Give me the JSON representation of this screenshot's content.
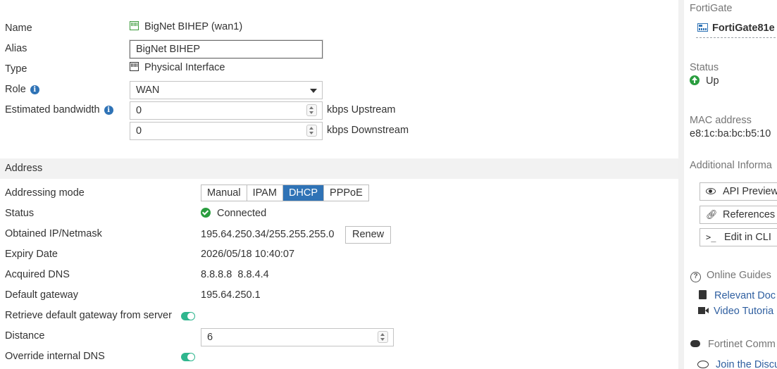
{
  "form": {
    "name_label": "Name",
    "name_value": "BigNet BIHEP (wan1)",
    "alias_label": "Alias",
    "alias_value": "BigNet BIHEP",
    "type_label": "Type",
    "type_value": "Physical Interface",
    "role_label": "Role",
    "role_value": "WAN",
    "bandwidth_label": "Estimated bandwidth",
    "upstream_value": "0",
    "upstream_unit": "kbps Upstream",
    "downstream_value": "0",
    "downstream_unit": "kbps Downstream"
  },
  "address": {
    "section_title": "Address",
    "mode_label": "Addressing mode",
    "modes": [
      "Manual",
      "IPAM",
      "DHCP",
      "PPPoE"
    ],
    "active_mode": "DHCP",
    "status_label": "Status",
    "status_value": "Connected",
    "ip_label": "Obtained IP/Netmask",
    "ip_value": "195.64.250.34/255.255.255.0",
    "renew_label": "Renew",
    "expiry_label": "Expiry Date",
    "expiry_value": "2026/05/18 10:40:07",
    "dns_label": "Acquired DNS",
    "dns_value": "8.8.8.8  8.8.4.4",
    "gateway_label": "Default gateway",
    "gateway_value": "195.64.250.1",
    "retrieve_label": "Retrieve default gateway from server",
    "retrieve_enabled": true,
    "distance_label": "Distance",
    "distance_value": "6",
    "override_dns_label": "Override internal DNS",
    "override_dns_enabled": true
  },
  "sidebar": {
    "device_label": "FortiGate",
    "device_value": "FortiGate81e",
    "status_label": "Status",
    "status_value": "Up",
    "mac_label": "MAC address",
    "mac_value": "e8:1c:ba:bc:b5:10",
    "additional_label": "Additional Informa",
    "api_preview_label": "API Preview",
    "references_label": "References",
    "edit_cli_label": "Edit in CLI",
    "online_guides_label": "Online Guides",
    "relevant_docs_label": "Relevant Doc",
    "video_tutorials_label": "Video Tutoria",
    "community_label": "Fortinet Comm",
    "join_discussion_label": "Join the Discu"
  },
  "colors": {
    "accent": "#2f73b6",
    "success": "#2a9d3f",
    "toggle_on": "#2fb68e"
  }
}
